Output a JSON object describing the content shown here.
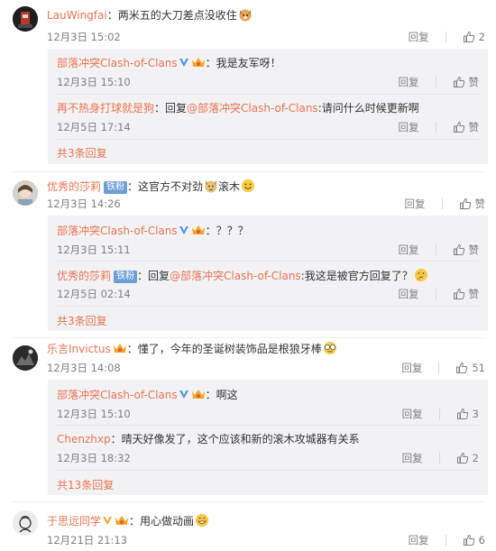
{
  "comments": [
    {
      "user": "LauWingfai",
      "text": "：两米五的大刀差点没收住",
      "time": "12月3日 15:02",
      "reply": "回复",
      "likes": "2",
      "replies": [
        {
          "user": "部落冲突Clash-of-Clans",
          "text": "：我是友军呀！",
          "time": "12月3日 15:10",
          "reply": "回复",
          "likes": "赞"
        },
        {
          "user": "再不热身打球就是狗",
          "text": "：回复",
          "mention": "@部落冲突Clash-of-Clans",
          "text2": ":请问什么时候更新啊",
          "time": "12月5日 17:14",
          "reply": "回复",
          "likes": "赞"
        }
      ],
      "more": "共3条回复"
    },
    {
      "user": "优秀的莎莉",
      "badge": "铁粉",
      "text": "：这官方不对劲",
      "text2": "滚木",
      "time": "12月3日 14:26",
      "reply": "回复",
      "likes": "赞",
      "replies": [
        {
          "user": "部落冲突Clash-of-Clans",
          "text": "：？？？",
          "time": "12月3日 15:11",
          "reply": "回复",
          "likes": "赞"
        },
        {
          "user": "优秀的莎莉",
          "badge": "铁粉",
          "text": "：回复",
          "mention": "@部落冲突Clash-of-Clans",
          "text2": ":我这是被官方回复了？",
          "time": "12月5日 02:14",
          "reply": "回复",
          "likes": "赞"
        }
      ],
      "more": "共3条回复"
    },
    {
      "user": "乐言Invictus",
      "text": "：懂了，今年的圣诞树装饰品是根狼牙棒",
      "time": "12月3日 14:08",
      "reply": "回复",
      "likes": "51",
      "replies": [
        {
          "user": "部落冲突Clash-of-Clans",
          "text": "：啊这",
          "time": "12月3日 15:10",
          "reply": "回复",
          "likes": "3"
        },
        {
          "user": "Chenzhxp",
          "text": "：晴天好像发了，这个应该和新的滚木攻城器有关系",
          "time": "12月3日 18:32",
          "reply": "回复",
          "likes": "2"
        }
      ],
      "more": "共13条回复"
    },
    {
      "user": "于思远同学",
      "text": "：用心做动画",
      "time": "12月21日 21:13",
      "reply": "回复",
      "likes": "6"
    }
  ],
  "colors": {
    "username": "#eb7350",
    "vbadge": "#4a90e2",
    "crown": "#f5a623",
    "fan_badge": "#6c9ed9",
    "sub_bg": "#f2f2f5"
  }
}
